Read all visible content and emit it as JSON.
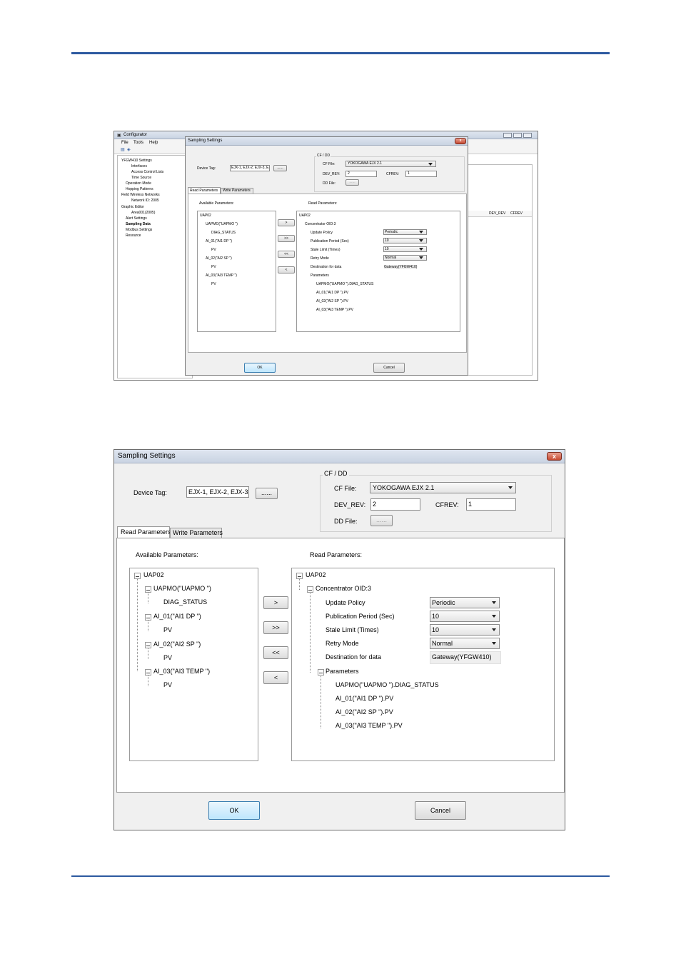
{
  "configurator": {
    "title": "Configurator",
    "menu": [
      "File",
      "Tools",
      "Help"
    ],
    "tree": [
      "YFGW410 Settings",
      "Interfaces",
      "Access Control Lists",
      "Time Source",
      "Operation Mode",
      "Hopping Patterns",
      "Field Wireless Networks",
      "Network ID: 2005",
      "Graphic Editor",
      "Area001(2005)",
      "Alert Settings",
      "Sampling Data",
      "Modbus Settings",
      "Resource"
    ],
    "grid_headers": [
      "DEV_REV",
      "CFREV"
    ]
  },
  "dialog": {
    "title": "Sampling Settings",
    "close_glyph": "x",
    "device_tag_label": "Device Tag:",
    "device_tag_value": "EJX-1, EJX-2, EJX-3, EJX-",
    "small_device_tag_value": "EJX-1, EJX-2, EJX-3, EJX-",
    "browse_label": "......",
    "cfdd_label": "CF / DD",
    "cf_file_label": "CF File:",
    "cf_file_value": "YOKOGAWA EJX 2.1",
    "dev_rev_label": "DEV_REV:",
    "dev_rev_value": "2",
    "cfrev_label": "CFREV:",
    "cfrev_value": "1",
    "dd_file_label": "DD File:",
    "dd_browse_label": "......",
    "tabs": [
      "Read Parameters",
      "Write Parameters"
    ],
    "available_label": "Available Parameters:",
    "read_label": "Read Parameters:",
    "available_tree": {
      "root": "UAP02",
      "uapmo": "UAPMO(\"UAPMO \")",
      "diag": "DIAG_STATUS",
      "ai01": "AI_01(\"AI1 DP     \")",
      "pv1": "PV",
      "ai02": "AI_02(\"AI2 SP     \")",
      "pv2": "PV",
      "ai03": "AI_03(\"AI3 TEMP \")",
      "pv3": "PV"
    },
    "move_buttons": [
      ">",
      ">>",
      "<<",
      "<"
    ],
    "read_tree": {
      "root": "UAP02",
      "concentrator": "Concentrator OID:3",
      "update_policy_label": "Update Policy",
      "update_policy_value": "Periodic",
      "publication_label": "Publication Period (Sec)",
      "publication_value": "10",
      "stale_label": "Stale Limit (Times)",
      "stale_value": "10",
      "retry_label": "Retry Mode",
      "retry_value": "Normal",
      "destination_label": "Destination for data",
      "destination_value": "Gateway(YFGW410)",
      "parameters_label": "Parameters",
      "p1": "UAPMO(\"UAPMO \").DIAG_STATUS",
      "p2": "AI_01(\"AI1 DP     \").PV",
      "p3": "AI_02(\"AI2 SP     \").PV",
      "p4": "AI_03(\"AI3 TEMP \").PV"
    },
    "ok_label": "OK",
    "cancel_label": "Cancel"
  }
}
